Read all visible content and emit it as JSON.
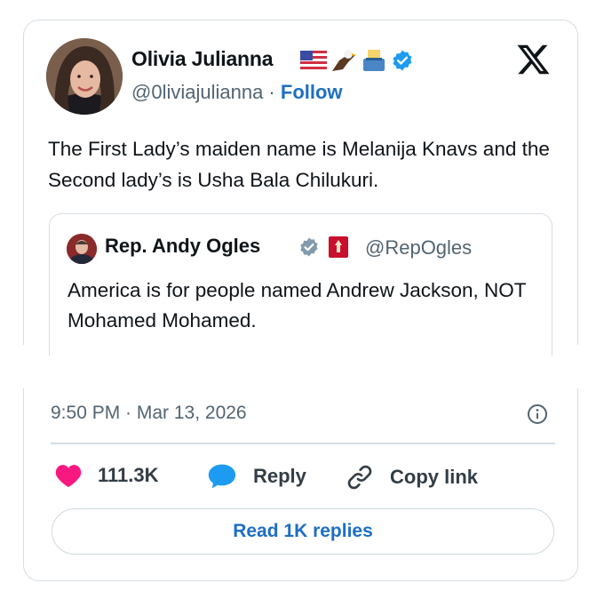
{
  "author": {
    "name": "Olivia Julianna",
    "handle": "@0liviajulianna",
    "separator": " · ",
    "follow_label": "Follow",
    "badges": [
      "flag-usa-emoji",
      "eagle-emoji",
      "ballot-box-emoji",
      "verified-badge-icon"
    ]
  },
  "tweet": {
    "text": "The First Lady’s maiden name is Melanija Knavs and the Second lady’s is Usha Bala Chilukuri."
  },
  "quote": {
    "name": "Rep. Andy Ogles",
    "handle": "@RepOgles",
    "text": "America is for people named Andrew Jackson, NOT Mohamed Mohamed.",
    "badges": [
      "verified-gray-badge-icon",
      "house-seal-icon"
    ]
  },
  "meta": {
    "timestamp": "9:50 PM · Mar 13, 2026"
  },
  "actions": {
    "likes": "111.3K",
    "reply_label": "Reply",
    "copy_label": "Copy link"
  },
  "read_replies_label": "Read 1K replies",
  "colors": {
    "accent": "#1d6fc4",
    "like": "#f91880",
    "reply_icon": "#1d9bf0",
    "border": "#d6dde3",
    "muted": "#536471"
  }
}
